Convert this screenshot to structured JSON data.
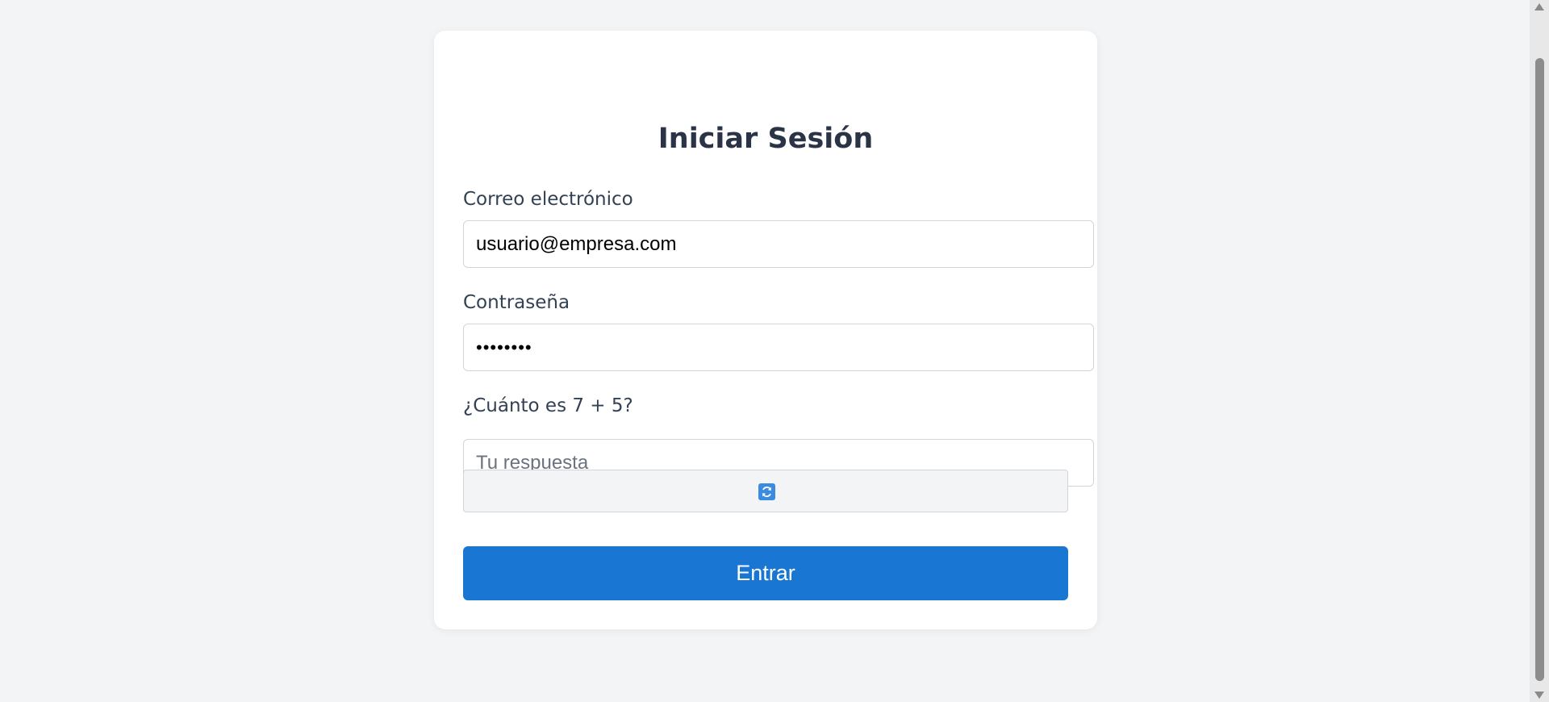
{
  "login": {
    "title": "Iniciar Sesión",
    "email_label": "Correo electrónico",
    "email_value": "usuario@empresa.com",
    "password_label": "Contraseña",
    "password_value": "password",
    "captcha_question": "¿Cuánto es 7 + 5?",
    "captcha_placeholder": "Tu respuesta",
    "captcha_refresh_icon": "refresh-icon",
    "submit_label": "Entrar"
  },
  "colors": {
    "background": "#f3f4f6",
    "card": "#ffffff",
    "title": "#2b3447",
    "primary_button": "#1976d2",
    "refresh_icon": "#3b8be0"
  }
}
